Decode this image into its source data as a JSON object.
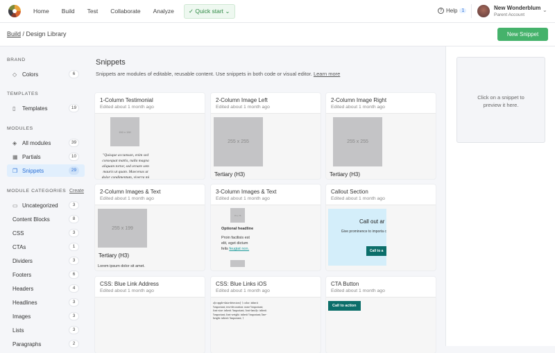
{
  "nav": {
    "items": [
      "Home",
      "Build",
      "Test",
      "Collaborate",
      "Analyze"
    ],
    "quick_start": "Quick start",
    "help": "Help",
    "help_badge": "1",
    "account_name": "New Wonderblum",
    "account_type": "Parent Account"
  },
  "breadcrumb": {
    "parent": "Build",
    "current": "/ Design Library"
  },
  "new_button": "New Snippet",
  "sidebar": {
    "brand": "BRAND",
    "brand_items": [
      {
        "label": "Colors",
        "count": "6"
      }
    ],
    "templates": "TEMPLATES",
    "template_items": [
      {
        "label": "Templates",
        "count": "19"
      }
    ],
    "modules": "MODULES",
    "module_items": [
      {
        "label": "All modules",
        "count": "39"
      },
      {
        "label": "Partials",
        "count": "10"
      },
      {
        "label": "Snippets",
        "count": "29"
      }
    ],
    "categories": "MODULE CATEGORIES",
    "create": "Create",
    "category_items": [
      {
        "label": "Uncategorized",
        "count": "3"
      },
      {
        "label": "Content Blocks",
        "count": "8"
      },
      {
        "label": "CSS",
        "count": "3"
      },
      {
        "label": "CTAs",
        "count": "1"
      },
      {
        "label": "Dividers",
        "count": "3"
      },
      {
        "label": "Footers",
        "count": "6"
      },
      {
        "label": "Headers",
        "count": "4"
      },
      {
        "label": "Headlines",
        "count": "3"
      },
      {
        "label": "Images",
        "count": "3"
      },
      {
        "label": "Lists",
        "count": "3"
      },
      {
        "label": "Paragraphs",
        "count": "2"
      }
    ]
  },
  "main": {
    "title": "Snippets",
    "description": "Snippets are modules of editable, reusable content. Use snippets in both code or visual editor.",
    "learn_more": "Learn more"
  },
  "cards": [
    {
      "title": "1-Column Testimonial",
      "edited": "Edited about 1 month ago",
      "img": "150 x 150",
      "text": "\"Quisque accumsan, enim sed consequat mattis, nulla magna aliquam tortor, sed ornare sem mauris ut quam. Maecenas ut dolor condimentum, viverra mi"
    },
    {
      "title": "2-Column Image Left",
      "edited": "Edited about 1 month ago",
      "img": "255 x 255",
      "heading": "Tertiary (H3)"
    },
    {
      "title": "2-Column Image Right",
      "edited": "Edited about 1 month ago",
      "img": "255 x 255",
      "heading": "Tertiary (H3)"
    },
    {
      "title": "2-Column Images & Text",
      "edited": "Edited about 1 month ago",
      "img": "255 x 199",
      "heading": "Tertiary (H3)",
      "text": "Lorem ipsum dolor sit amet."
    },
    {
      "title": "3-Column Images & Text",
      "edited": "Edited about 1 month ago",
      "img": "75 x 75",
      "heading": "Optional headline",
      "text": "Proin facilisis est elit, eget dictum felis",
      "link": "feugiat non."
    },
    {
      "title": "Callout Section",
      "edited": "Edited about 1 month ago",
      "heading": "Call out ar",
      "text": "Give prominence to importa callout se",
      "button": "Call to a"
    },
    {
      "title": "CSS: Blue Link Address",
      "edited": "Edited about 1 month ago"
    },
    {
      "title": "CSS: Blue Links iOS",
      "edited": "Edited about 1 month ago",
      "code": "a[x-apple-data-detectors] { color: inherit !important; text-decoration: none !important; font-size: inherit !important; font-family: inherit !important; font-weight: inherit !important; line-height: inherit !important; }"
    },
    {
      "title": "CTA Button",
      "edited": "Edited about 1 month ago",
      "button": "Call to action"
    }
  ],
  "preview_panel": {
    "text": "Click on a snippet to preview it here."
  }
}
